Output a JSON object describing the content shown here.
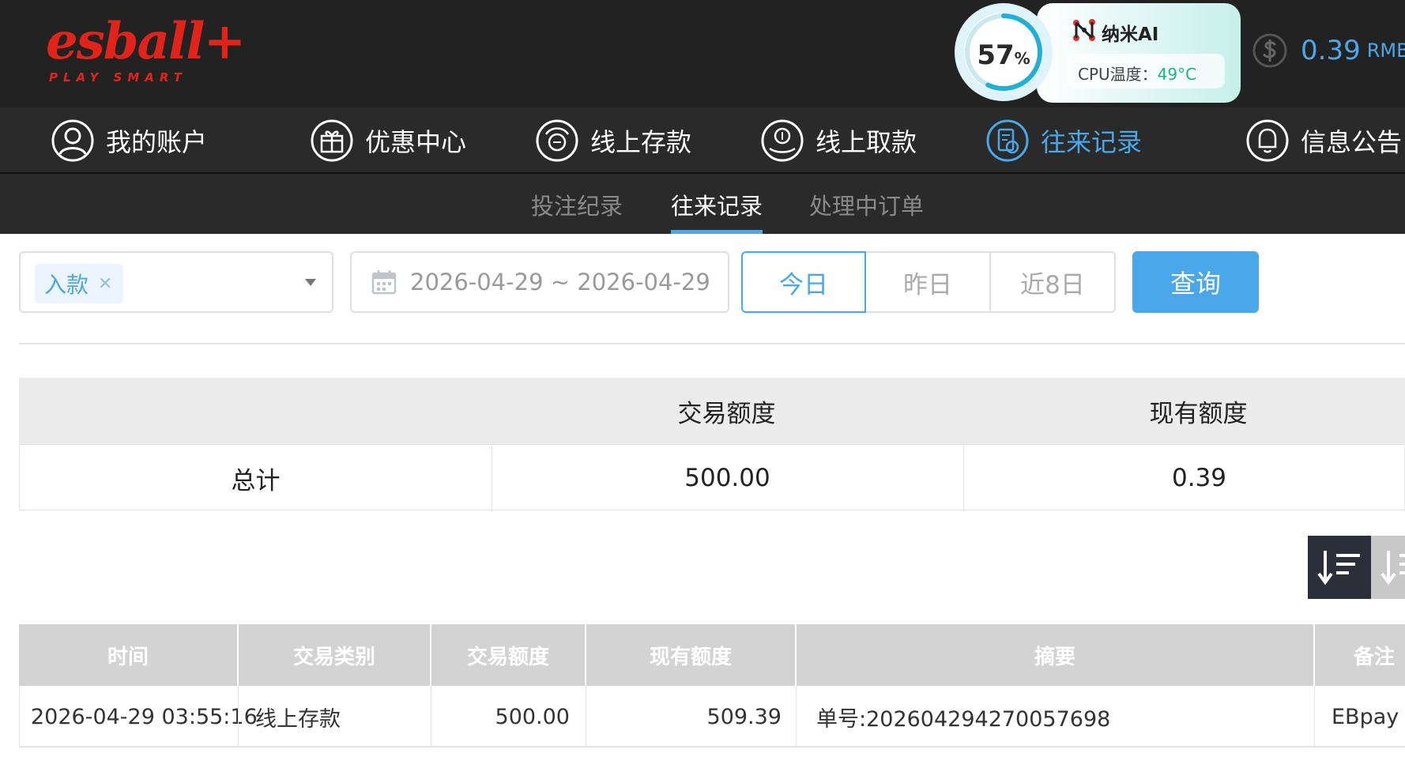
{
  "header": {
    "logo_main": "esball+",
    "logo_sub": "PLAY SMART",
    "ai_widget": {
      "percent": "57",
      "percent_unit": "%",
      "percent_value": 57,
      "title": "纳米AI",
      "cpu_label": "CPU温度：",
      "cpu_value": "49°C"
    },
    "balance": {
      "amount": "0.39",
      "unit": "RMB"
    }
  },
  "main_nav": {
    "items": [
      {
        "label": "我的账户",
        "icon": "user-icon"
      },
      {
        "label": "优惠中心",
        "icon": "gift-icon"
      },
      {
        "label": "线上存款",
        "icon": "deposit-icon"
      },
      {
        "label": "线上取款",
        "icon": "withdraw-icon"
      },
      {
        "label": "往来记录",
        "icon": "records-icon",
        "active": true
      },
      {
        "label": "信息公告",
        "icon": "bell-icon"
      }
    ],
    "active_color": "#4aa8ea"
  },
  "sub_nav": {
    "items": [
      {
        "label": "投注纪录"
      },
      {
        "label": "往来记录",
        "active": true
      },
      {
        "label": "处理中订单"
      }
    ]
  },
  "filters": {
    "type_tag": "入款",
    "date_range": "2026-04-29 ~ 2026-04-29",
    "quick_ranges": [
      "今日",
      "昨日",
      "近8日"
    ],
    "query_label": "查询"
  },
  "summary": {
    "headers": [
      "",
      "交易额度",
      "现有额度"
    ],
    "row": [
      "总计",
      "500.00",
      "0.39"
    ]
  },
  "records": {
    "headers": [
      "时间",
      "交易类别",
      "交易额度",
      "现有额度",
      "摘要",
      "备注"
    ],
    "rows": [
      [
        "2026-04-29 03:55:16",
        "线上存款",
        "500.00",
        "509.39",
        "单号:202604294270057698",
        "EBpay"
      ]
    ]
  },
  "colors": {
    "accent": "#4aa8ea",
    "header_bg": "#222222",
    "nav_bg": "#2a2a2a",
    "brand_red": "#e2231a",
    "table_head": "#d3d3d3"
  }
}
